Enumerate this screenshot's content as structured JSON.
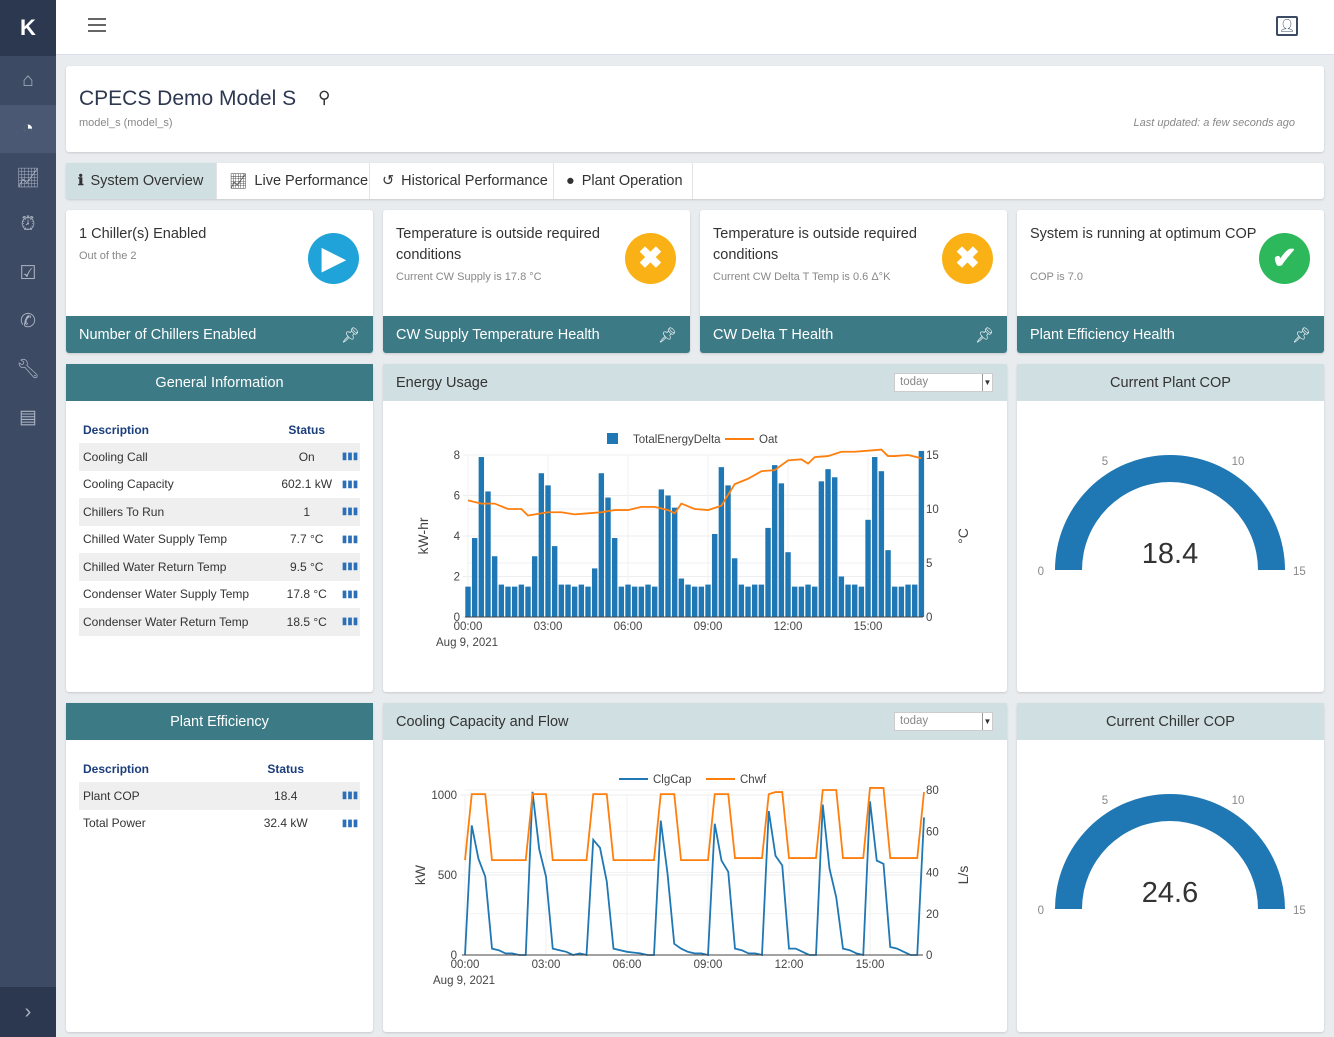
{
  "app": {
    "logo": "K",
    "menu_icon": "hamburger-icon",
    "user_icon": "user-portrait-icon"
  },
  "sidebar": {
    "items": [
      {
        "icon": "home-icon"
      },
      {
        "icon": "dashboard-gauge-icon",
        "active": true
      },
      {
        "icon": "chart-line-icon"
      },
      {
        "icon": "alarm-clock-icon"
      },
      {
        "icon": "checkbox-icon"
      },
      {
        "icon": "phone-icon"
      },
      {
        "icon": "wrench-icon"
      },
      {
        "icon": "store-icon"
      }
    ],
    "collapse_icon": "chevron-right-icon"
  },
  "header": {
    "title": "CPECS Demo Model S",
    "subtitle": "model_s (model_s)",
    "last_updated": "Last updated: a few seconds ago"
  },
  "tabs": [
    {
      "label": "System Overview",
      "icon": "info-icon",
      "active": true
    },
    {
      "label": "Live Performance",
      "icon": "area-chart-icon"
    },
    {
      "label": "Historical Performance",
      "icon": "history-icon"
    },
    {
      "label": "Plant Operation",
      "icon": "clock-icon"
    }
  ],
  "status_cards": [
    {
      "title": "1 Chiller(s) Enabled",
      "sub": "Out of the 2",
      "footer": "Number of Chillers Enabled",
      "icon": "play-icon",
      "color": "#1fa3d8"
    },
    {
      "title": "Temperature is outside required conditions",
      "sub": "Current CW Supply is 17.8 °C",
      "footer": "CW Supply Temperature Health",
      "icon": "x-icon",
      "color": "#f9b115"
    },
    {
      "title": "Temperature is outside required conditions",
      "sub": "Current CW Delta T Temp is 0.6 Δ°K",
      "footer": "CW Delta T Health",
      "icon": "x-icon",
      "color": "#f9b115"
    },
    {
      "title": "System is running at optimum COP",
      "sub": "COP is 7.0",
      "footer": "Plant Efficiency Health",
      "icon": "check-icon",
      "color": "#2eb85c"
    }
  ],
  "general_info": {
    "title": "General Information",
    "headers": [
      "Description",
      "Status"
    ],
    "rows": [
      [
        "Cooling Call",
        "On"
      ],
      [
        "Cooling Capacity",
        "602.1 kW"
      ],
      [
        "Chillers To Run",
        "1"
      ],
      [
        "Chilled Water Supply Temp",
        "7.7 °C"
      ],
      [
        "Chilled Water Return Temp",
        "9.5 °C"
      ],
      [
        "Condenser Water Supply Temp",
        "17.8 °C"
      ],
      [
        "Condenser Water Return Temp",
        "18.5 °C"
      ]
    ]
  },
  "plant_efficiency": {
    "title": "Plant Efficiency",
    "headers": [
      "Description",
      "Status"
    ],
    "rows": [
      [
        "Plant COP",
        "18.4"
      ],
      [
        "Total Power",
        "32.4 kW"
      ]
    ]
  },
  "energy_panel": {
    "title": "Energy Usage",
    "range": "today"
  },
  "cooling_panel": {
    "title": "Cooling Capacity and Flow",
    "range": "today"
  },
  "plant_cop": {
    "title": "Current Plant COP",
    "value": "18.4",
    "min": "0",
    "max": "15",
    "ticks": [
      "0",
      "5",
      "10",
      "15"
    ],
    "color": "#1f77b4"
  },
  "chiller_cop": {
    "title": "Current Chiller COP",
    "value": "24.6",
    "min": "0",
    "max": "15",
    "ticks": [
      "0",
      "5",
      "10",
      "15"
    ],
    "color": "#1f77b4"
  },
  "chart_data": [
    {
      "type": "bar+line",
      "xlabel": "",
      "date_label": "Aug 9, 2021",
      "ylabel": "kW-hr",
      "y2label": "°C",
      "ylim": [
        0,
        8
      ],
      "y2lim": [
        0,
        15
      ],
      "yticks": [
        "0",
        "2",
        "4",
        "6",
        "8"
      ],
      "y2ticks": [
        "0",
        "5",
        "10",
        "15"
      ],
      "xticks": [
        "00:00",
        "03:00",
        "06:00",
        "09:00",
        "12:00",
        "15:00"
      ],
      "grid": true,
      "legend": "top",
      "series": [
        {
          "name": "TotalEnergyDelta",
          "type": "bar",
          "color": "#1f77b4",
          "x_start": "00:00",
          "x_step_minutes": 15,
          "values": [
            1.5,
            3.9,
            7.9,
            6.2,
            3.0,
            1.6,
            1.5,
            1.5,
            1.6,
            1.5,
            3.0,
            7.1,
            6.5,
            3.5,
            1.6,
            1.6,
            1.5,
            1.6,
            1.5,
            2.4,
            7.1,
            5.9,
            3.9,
            1.5,
            1.6,
            1.5,
            1.5,
            1.6,
            1.5,
            6.3,
            6.0,
            5.4,
            1.9,
            1.6,
            1.5,
            1.5,
            1.6,
            4.1,
            7.4,
            6.5,
            2.9,
            1.6,
            1.5,
            1.6,
            1.6,
            4.4,
            7.5,
            6.6,
            3.2,
            1.5,
            1.5,
            1.6,
            1.5,
            6.7,
            7.3,
            6.9,
            2.0,
            1.6,
            1.6,
            1.5,
            4.8,
            7.9,
            7.2,
            3.3,
            1.5,
            1.5,
            1.6,
            1.6,
            8.2
          ]
        },
        {
          "name": "Oat",
          "type": "line",
          "axis": "y2",
          "color": "#ff7f0e",
          "points": [
            [
              "00:00",
              10.8
            ],
            [
              "00:30",
              10.5
            ],
            [
              "01:00",
              10.5
            ],
            [
              "01:30",
              10.0
            ],
            [
              "02:00",
              10.0
            ],
            [
              "02:15",
              9.4
            ],
            [
              "03:00",
              9.7
            ],
            [
              "03:30",
              9.7
            ],
            [
              "04:00",
              9.5
            ],
            [
              "04:30",
              9.6
            ],
            [
              "05:00",
              9.7
            ],
            [
              "05:30",
              9.9
            ],
            [
              "06:00",
              9.9
            ],
            [
              "06:30",
              10.2
            ],
            [
              "07:00",
              10.2
            ],
            [
              "07:30",
              9.9
            ],
            [
              "07:45",
              9.6
            ],
            [
              "08:00",
              10.5
            ],
            [
              "08:30",
              10.0
            ],
            [
              "09:00",
              9.9
            ],
            [
              "09:30",
              10.3
            ],
            [
              "10:00",
              12.3
            ],
            [
              "10:30",
              12.8
            ],
            [
              "11:00",
              13.5
            ],
            [
              "11:30",
              13.6
            ],
            [
              "12:00",
              14.5
            ],
            [
              "12:30",
              14.6
            ],
            [
              "12:45",
              14.2
            ],
            [
              "13:00",
              14.8
            ],
            [
              "13:30",
              14.9
            ],
            [
              "14:00",
              15.3
            ],
            [
              "14:30",
              15.3
            ],
            [
              "15:00",
              15.4
            ],
            [
              "15:30",
              15.5
            ],
            [
              "15:45",
              14.9
            ],
            [
              "16:00",
              14.9
            ],
            [
              "16:30",
              15.0
            ],
            [
              "17:00",
              14.7
            ]
          ]
        }
      ]
    },
    {
      "type": "line",
      "date_label": "Aug 9, 2021",
      "ylabel": "kW",
      "y2label": "L/s",
      "ylim": [
        0,
        1000
      ],
      "y2lim": [
        0,
        80
      ],
      "yticks": [
        "0",
        "500",
        "1000"
      ],
      "y2ticks": [
        "0",
        "20",
        "40",
        "60",
        "80"
      ],
      "xticks": [
        "00:00",
        "03:00",
        "06:00",
        "09:00",
        "12:00",
        "15:00"
      ],
      "grid": true,
      "legend": "top",
      "series": [
        {
          "name": "ClgCap",
          "color": "#1f77b4",
          "x_start": "00:00",
          "x_step_minutes": 15,
          "values": [
            0,
            810,
            600,
            490,
            40,
            30,
            10,
            10,
            0,
            0,
            1020,
            660,
            490,
            40,
            30,
            20,
            0,
            10,
            0,
            720,
            670,
            460,
            40,
            30,
            20,
            15,
            10,
            0,
            0,
            840,
            510,
            70,
            40,
            20,
            10,
            10,
            0,
            820,
            590,
            520,
            40,
            30,
            10,
            10,
            0,
            900,
            620,
            560,
            40,
            40,
            20,
            0,
            0,
            940,
            540,
            360,
            40,
            30,
            10,
            0,
            960,
            590,
            570,
            50,
            40,
            20,
            0,
            0,
            860
          ]
        },
        {
          "name": "Chwf",
          "axis": "y2",
          "color": "#ff7f0e",
          "x_start": "00:00",
          "x_step_minutes": 15,
          "values": [
            46,
            78,
            78,
            78,
            46,
            46,
            46,
            46,
            46,
            46,
            78,
            78,
            78,
            46,
            46,
            46,
            46,
            46,
            46,
            78,
            78,
            78,
            46,
            46,
            46,
            46,
            46,
            46,
            46,
            78,
            78,
            78,
            46,
            46,
            46,
            46,
            46,
            78,
            78,
            78,
            47,
            47,
            47,
            47,
            47,
            78,
            79,
            79,
            47,
            47,
            47,
            47,
            47,
            80,
            80,
            80,
            47,
            47,
            47,
            47,
            81,
            81,
            81,
            47,
            47,
            47,
            47,
            47,
            79
          ]
        }
      ]
    }
  ]
}
